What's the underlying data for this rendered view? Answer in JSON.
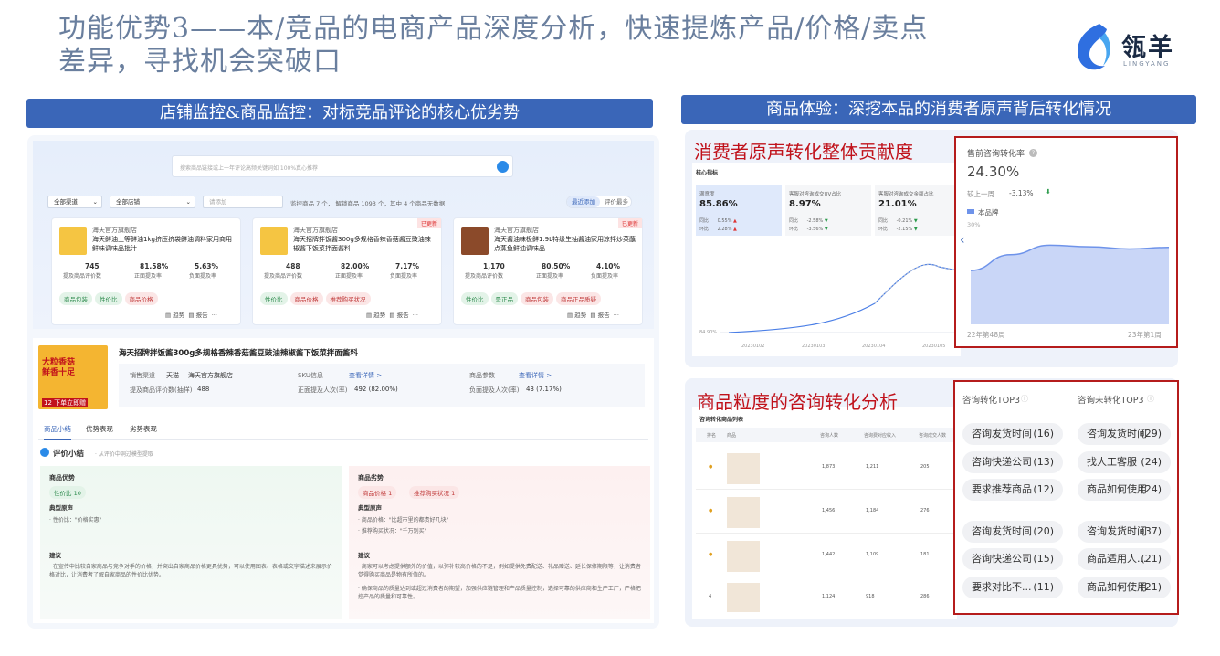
{
  "title": "功能优势3——本/竞品的电商产品深度分析，快速提炼产品/价格/卖点差异，寻找机会突破口",
  "logo": {
    "brand": "瓴羊",
    "sub": "LINGYANG"
  },
  "left_band": "店铺监控&商品监控：对标竞品评论的核心优劣势",
  "right_band": "商品体验：深挖本品的消费者原声背后转化情况",
  "search_placeholder": "搜索商品链接或上一年评论高频关键词如 100%真心推荐",
  "filters": {
    "channel": "全部渠道",
    "store": "全部店铺",
    "add": "请添加",
    "summary": "监控商品 7 个，  解锁商品 1093 个，其中 4 个商品无数据",
    "latest": "最近添加",
    "eval_most": "评价最多"
  },
  "products": [
    {
      "store": "海天官方旗舰店",
      "name": "海天鲜油上等鲜油1kg挤压挤袋鲜油调料家用商用鲜味调味品批汁",
      "v1": "745",
      "l1": "提及商品评价数",
      "v2": "81.58%",
      "l2": "正面提及率",
      "v3": "5.63%",
      "l3": "负面提及率",
      "tags": [
        "商品包装",
        "性价比",
        "商品价格"
      ],
      "badge": ""
    },
    {
      "store": "海天官方旗舰店",
      "name": "海天招牌拌饭酱300g多规格香辣香菇酱豆豉油辣椒酱下饭菜拌面酱料",
      "v1": "488",
      "l1": "提及商品评价数",
      "v2": "82.00%",
      "l2": "正面提及率",
      "v3": "7.17%",
      "l3": "负面提及率",
      "tags": [
        "性价比",
        "商品价格",
        "推荐购买状况"
      ],
      "badge": "已更新"
    },
    {
      "store": "海天官方旗舰店",
      "name": "海天酱油味极鲜1.9L特级生抽酱油家用凉拌炒菜蘸点蒸鱼鲜油调味品",
      "v1": "1,170",
      "l1": "提及商品评价数",
      "v2": "80.50%",
      "l2": "正面提及率",
      "v3": "4.10%",
      "l3": "负面提及率",
      "tags": [
        "性价比",
        "是正品",
        "商品包装",
        "商品正品质疑"
      ],
      "badge": "已更新"
    }
  ],
  "card_actions": {
    "trend": "趋势",
    "report": "报告",
    "more": "···"
  },
  "detail": {
    "title": "海天招牌拌饭酱300g多规格香辣香菇酱豆豉油辣椒酱下饭菜拌面酱料",
    "promo": "大粒香菇 鲜香十足",
    "promo2": "12 下单立即赠",
    "channel_label": "销售渠道",
    "channel_val": "天猫",
    "store_val": "海天官方旗舰店",
    "mentions_label": "提及商品评价数(抽样)",
    "mentions_val": "488",
    "sku_label": "SKU信息",
    "sku_link": "查看详情 >",
    "pos_label": "正面提及人次(率)",
    "pos_val": "492 (82.00%)",
    "param_label": "商品参数",
    "param_link": "查看详情 >",
    "neg_label": "负面提及人次(率)",
    "neg_val": "43 (7.17%)"
  },
  "tabs": [
    "商品小结",
    "优势表现",
    "劣势表现"
  ],
  "review": {
    "title": "评价小结",
    "hint": "· 从评价中洞过模型提取",
    "adv": "商品优势",
    "adv_tag": "性价比 10",
    "typical": "典型原声",
    "adv_quote": "· 性价比：\"价格实惠\"",
    "disadv": "商品劣势",
    "dis_tag1": "商品价格 1",
    "dis_tag2": "推荐购买状况 1",
    "dis_quote1": "· 商品价格：\"比超市里的都贵好几块\"",
    "dis_quote2": "· 推荐购买状况：\"千万别买\"",
    "suggest": "建议",
    "adv_suggest": "· 在宣传中比较自家商品与竞争对手的价格，并突出自家商品价格更具优势，可以使用图表、表格或文字描述来展示价格对比，让消费者了解自家商品的性价比优势。",
    "dis_suggest1": "· 商家可以考虑提供额外的价值，以弥补较高价格的不足，例如提供免费配送、礼品赠送、延长保修期限等，让消费者觉得购买商品是物有所值的。",
    "dis_suggest2": "· 确保商品的质量达到或超过消费者的期望，加强供应链管理和产品质量控制，选择可靠的供应商和生产工厂，严格把控产品的质量和可靠性。"
  },
  "voice": {
    "title": "消费者原声转化整体贡献度",
    "core": "核心指标",
    "m1_label": "满意度",
    "m1_val": "85.86%",
    "m2_label": "客服对咨询成交UV占比",
    "m2_val": "8.97%",
    "m3_label": "客服对咨询成交金额占比",
    "m3_val": "21.01%",
    "yoy": "同比",
    "mom": "环比",
    "m1_yoy": "0.55%",
    "m1_mom": "2.28%",
    "m2_yoy": "-2.58%",
    "m2_mom": "-3.56%",
    "m3_yoy": "-0.21%",
    "m3_mom": "-2.15%",
    "ymin": "84.90%",
    "dates": [
      "20230102",
      "20230103",
      "20230104",
      "20230105"
    ]
  },
  "conv": {
    "title": "售前咨询转化率",
    "value": "24.30%",
    "compare_label": "较上一周",
    "compare_val": "-3.13%",
    "legend": "本品牌",
    "y_top": "30%",
    "x_start": "22年第48周",
    "x_end": "23年第1周"
  },
  "chart_data": [
    {
      "type": "area",
      "series": [
        {
          "name": "本品牌",
          "values": [
            17,
            22,
            25,
            24.5,
            23.8,
            24.3
          ]
        }
      ],
      "ylim": [
        0,
        30
      ],
      "x": [
        "22年第48周",
        "",
        "",
        "",
        "",
        "23年第1周"
      ]
    }
  ],
  "consult": {
    "title": "商品粒度的咨询转化分析",
    "table_title": "咨询转化商品列表",
    "cols": [
      "排名",
      "商品",
      "咨询人数",
      "咨询费对应收入",
      "咨询成交人数"
    ],
    "rows": [
      [
        "1",
        "1,873",
        "1,211",
        "205"
      ],
      [
        "2",
        "1,456",
        "1,184",
        "276"
      ],
      [
        "3",
        "1,442",
        "1,109",
        "181"
      ],
      [
        "4",
        "1,124",
        "918",
        "286"
      ]
    ]
  },
  "top3": {
    "h1": "咨询转化TOP3",
    "h2": "咨询未转化TOP3",
    "left": [
      [
        "咨询发货时间",
        "(16)"
      ],
      [
        "咨询快递公司",
        "(13)"
      ],
      [
        "要求推荐商品",
        "(12)"
      ],
      [
        "咨询发货时间",
        "(20)"
      ],
      [
        "咨询快递公司",
        "(15)"
      ],
      [
        "要求对比不...",
        "(11)"
      ]
    ],
    "right": [
      [
        "咨询发货时间",
        "(29)"
      ],
      [
        "找人工客服",
        "(24)"
      ],
      [
        "商品如何使用",
        "(24)"
      ],
      [
        "咨询发货时间",
        "(37)"
      ],
      [
        "商品适用人...",
        "(21)"
      ],
      [
        "商品如何使用",
        "(21)"
      ]
    ]
  },
  "colors": {
    "accent": "#3a66b8",
    "red": "#c0121b",
    "chart_fill": "#c9d6f7"
  }
}
